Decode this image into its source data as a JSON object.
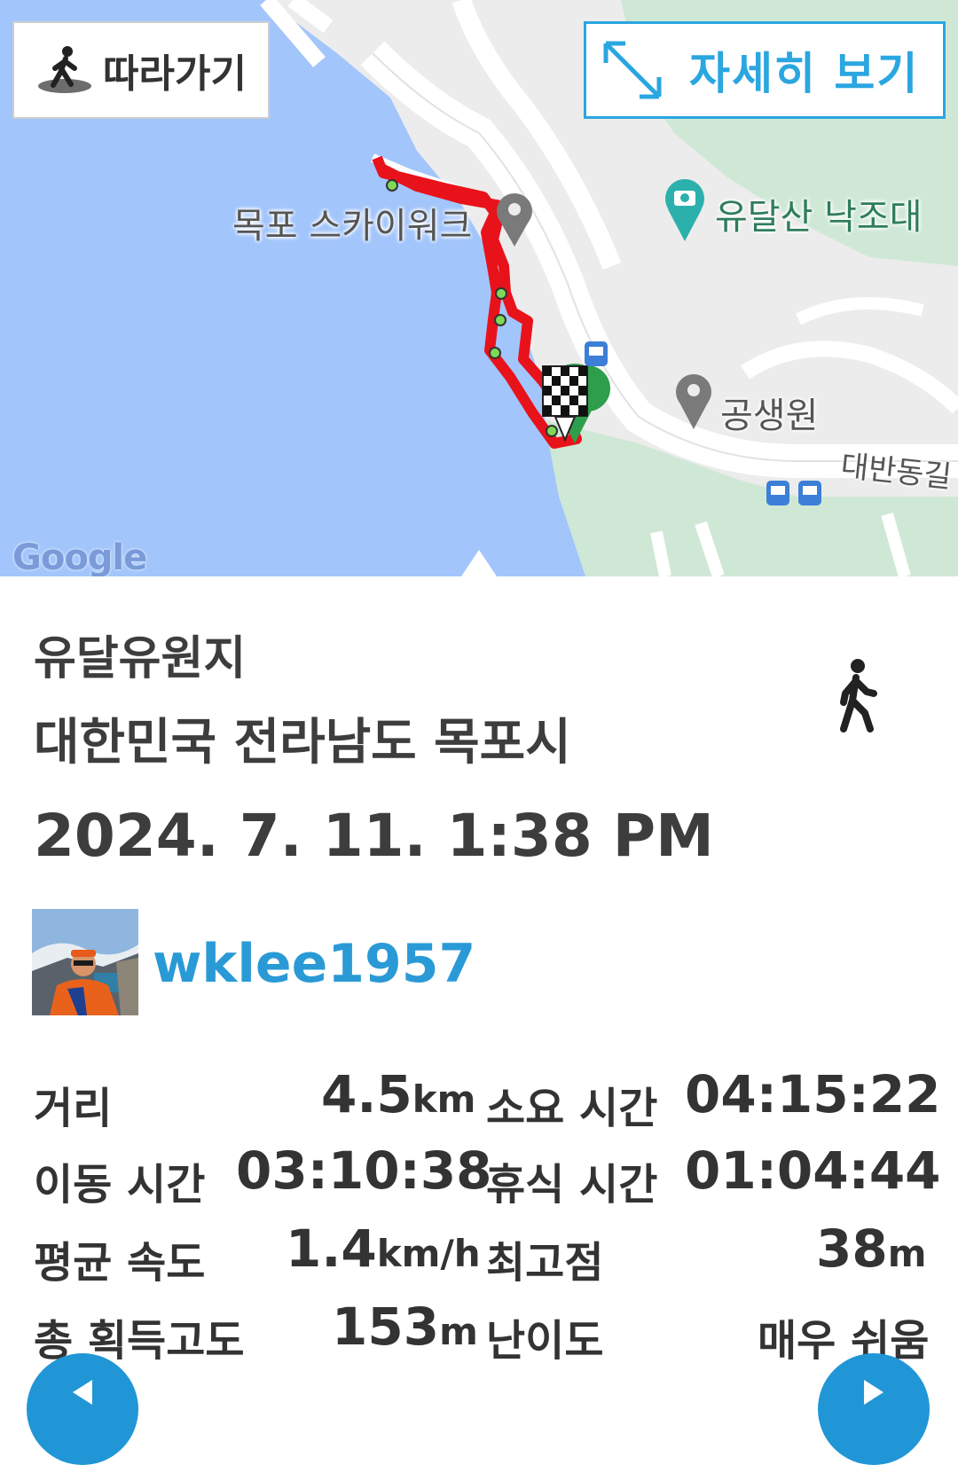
{
  "map": {
    "follow_label": "따라가기",
    "detail_label": "자세히 보기",
    "labels": {
      "skywalk": "목포 스카이워크",
      "yudalsan": "유달산 낙조대",
      "gongsaengwon": "공생원",
      "daebandonggil": "대반동길"
    },
    "attribution": "Google",
    "icons": {
      "follow": "walking-person-icon",
      "expand": "expand-arrows-icon",
      "finish": "checkered-flag-pin-icon",
      "place": "map-pin-icon",
      "photo_spot": "camera-pin-icon",
      "bus": "bus-stop-icon"
    },
    "colors": {
      "water": "#a2c5fb",
      "route": "#e8121b",
      "accent": "#2aa6e0"
    }
  },
  "track": {
    "title": "유달유원지",
    "address": "대한민국 전라남도 목포시",
    "datetime": "2024. 7. 11. 1:38 PM",
    "activity_icon": "walking-icon",
    "user": {
      "name": "wklee1957",
      "avatar": "user-avatar"
    }
  },
  "stats": {
    "distance": {
      "label": "거리",
      "value": "4.5",
      "unit": "km"
    },
    "total_time": {
      "label": "소요 시간",
      "value": "04:15:22"
    },
    "moving_time": {
      "label": "이동 시간",
      "value": "03:10:38"
    },
    "rest_time": {
      "label": "휴식 시간",
      "value": "01:04:44"
    },
    "avg_speed": {
      "label": "평균 속도",
      "value": "1.4",
      "unit": "km/h"
    },
    "max_elevation": {
      "label": "최고점",
      "value": "38",
      "unit": "m"
    },
    "elevation_gain": {
      "label": "총 획득고도",
      "value": "153",
      "unit": "m"
    },
    "difficulty": {
      "label": "난이도",
      "value": "매우 쉬움"
    }
  }
}
